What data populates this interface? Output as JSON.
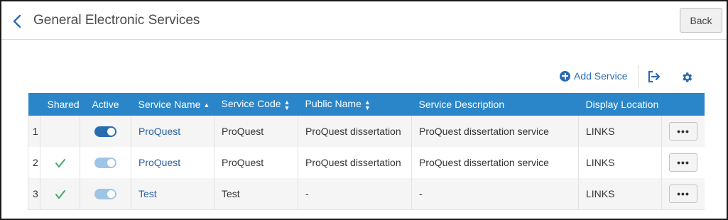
{
  "page": {
    "title": "General Electronic Services",
    "back_label": "Back"
  },
  "toolbar": {
    "add_label": "Add Service"
  },
  "colors": {
    "accent": "#2a86c9",
    "link": "#2a5fa5",
    "toggle_on": "#2a6cb0",
    "toggle_dim": "#9fc5e6",
    "check": "#3caa6a"
  },
  "table": {
    "columns": {
      "shared": "Shared",
      "active": "Active",
      "service_name": "Service Name",
      "service_code": "Service Code",
      "public_name": "Public Name",
      "service_description": "Service Description",
      "display_location": "Display Location"
    },
    "sort": {
      "service_name": "ascending"
    },
    "rows": [
      {
        "num": "1",
        "shared": false,
        "active": true,
        "active_dim": false,
        "service_name": "ProQuest",
        "service_code": "ProQuest",
        "public_name": "ProQuest dissertation",
        "service_description": "ProQuest dissertation service",
        "display_location": "LINKS",
        "more": "•••"
      },
      {
        "num": "2",
        "shared": true,
        "active": true,
        "active_dim": true,
        "service_name": "ProQuest",
        "service_code": "ProQuest",
        "public_name": "ProQuest dissertation",
        "service_description": "ProQuest dissertation service",
        "display_location": "LINKS",
        "more": "•••"
      },
      {
        "num": "3",
        "shared": true,
        "active": true,
        "active_dim": true,
        "service_name": "Test",
        "service_code": "Test",
        "public_name": "-",
        "service_description": "-",
        "display_location": "LINKS",
        "more": "•••"
      }
    ]
  }
}
